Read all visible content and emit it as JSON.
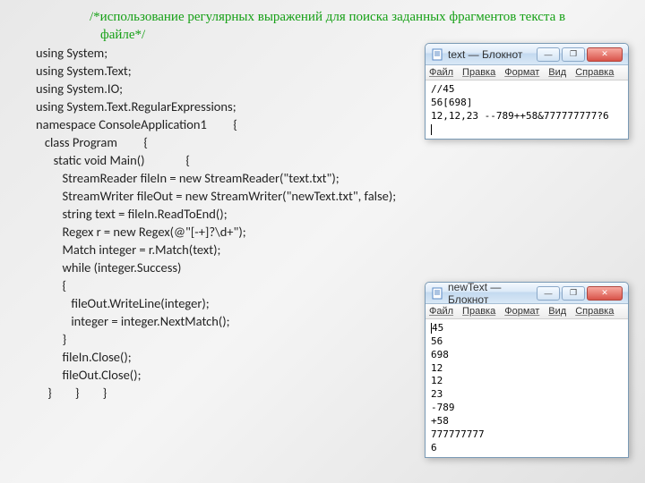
{
  "comment": "/*использование регулярных выражений для поиска заданных фрагментов текста в файле*/",
  "code": {
    "l1": "using System;",
    "l2": "using System.Text;",
    "l3": "using System.IO;",
    "l4": "using System.Text.RegularExpressions;",
    "l5": "",
    "l6": "namespace ConsoleApplication1         {",
    "l7": "   class Program         {",
    "l8": "      static void Main()              {",
    "l9": "         StreamReader fileIn = new StreamReader(\"text.txt\");",
    "l10": "         StreamWriter fileOut = new StreamWriter(\"newText.txt\", false);",
    "l11": "         string text = fileIn.ReadToEnd();",
    "l12": "         Regex r = new Regex(@\"[-+]?\\d+\");",
    "l13": "         Match integer = r.Match(text);",
    "l14": "         while (integer.Success)",
    "l15": "         {",
    "l16": "            fileOut.WriteLine(integer);",
    "l17": "            integer = integer.NextMatch();",
    "l18": "         }",
    "l19": "         fileIn.Close();",
    "l20": "         fileOut.Close();",
    "l21": "    }        }        }"
  },
  "notepad1": {
    "title": "text — Блокнот",
    "menu": {
      "m1": "Файл",
      "m2": "Правка",
      "m3": "Формат",
      "m4": "Вид",
      "m5": "Справка"
    },
    "body": "//45\n56[698]\n12,12,23 --789++58&777777777?6\n"
  },
  "notepad2": {
    "title": "newText — Блокнот",
    "menu": {
      "m1": "Файл",
      "m2": "Правка",
      "m3": "Формат",
      "m4": "Вид",
      "m5": "Справка"
    },
    "body": "45\n56\n698\n12\n12\n23\n-789\n+58\n777777777\n6"
  },
  "btn": {
    "min": "—",
    "max": "❐",
    "close": "✕"
  }
}
